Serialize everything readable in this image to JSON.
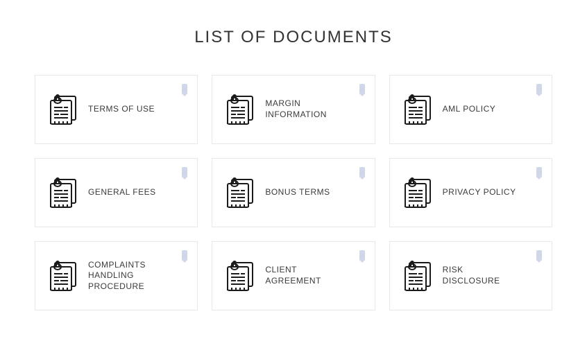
{
  "title": "LIST OF DOCUMENTS",
  "documents": [
    {
      "label": "TERMS OF USE"
    },
    {
      "label": "MARGIN INFORMATION"
    },
    {
      "label": "AML POLICY"
    },
    {
      "label": "GENERAL FEES"
    },
    {
      "label": "BONUS TERMS"
    },
    {
      "label": "PRIVACY POLICY"
    },
    {
      "label": "COMPLAINTS HANDLING PROCEDURE"
    },
    {
      "label": "CLIENT AGREEMENT"
    },
    {
      "label": "RISK DISCLOSURE"
    }
  ]
}
